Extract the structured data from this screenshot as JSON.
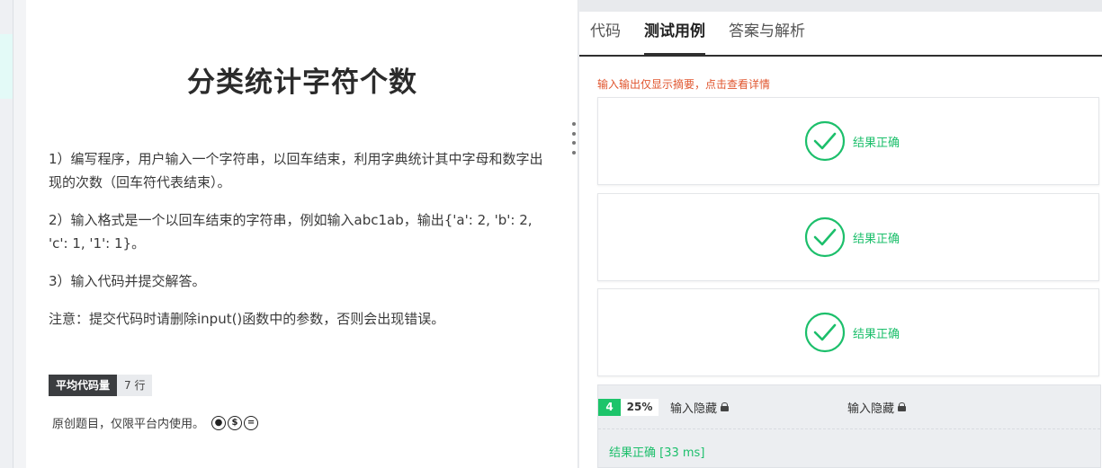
{
  "problem": {
    "title": "分类统计字符个数",
    "paragraphs": [
      "1）编写程序，用户输入一个字符串，以回车结束，利用字典统计其中字母和数字出现的次数（回车符代表结束）。",
      "2）输入格式是一个以回车结束的字符串，例如输入abc1ab，输出{'a': 2, 'b': 2, 'c': 1, '1': 1}。",
      "3）输入代码并提交解答。",
      "注意：提交代码时请删除input()函数中的参数，否则会出现错误。"
    ],
    "stat_label": "平均代码量",
    "stat_value": "7 行",
    "license_text": "原创题目，仅限平台内使用。"
  },
  "tabs": [
    {
      "label": "代码",
      "active": false
    },
    {
      "label": "测试用例",
      "active": true
    },
    {
      "label": "答案与解析",
      "active": false
    }
  ],
  "notice": "输入输出仅显示摘要，点击查看详情",
  "results": [
    {
      "label": "结果正确"
    },
    {
      "label": "结果正确"
    },
    {
      "label": "结果正确"
    }
  ],
  "summary": {
    "case_number": "4",
    "percent": "25%",
    "input_hidden": "输入隐藏",
    "output_hidden": "输入隐藏",
    "result": "结果正确 [33 ms]"
  },
  "colors": {
    "success": "#1cbf6b",
    "notice": "#e0552e",
    "badge": "#1cc46a"
  },
  "icons": {
    "check": "check-circle-icon",
    "lock": "lock-icon",
    "cc": [
      "cc-by-icon",
      "cc-nc-icon",
      "cc-nd-icon"
    ]
  }
}
